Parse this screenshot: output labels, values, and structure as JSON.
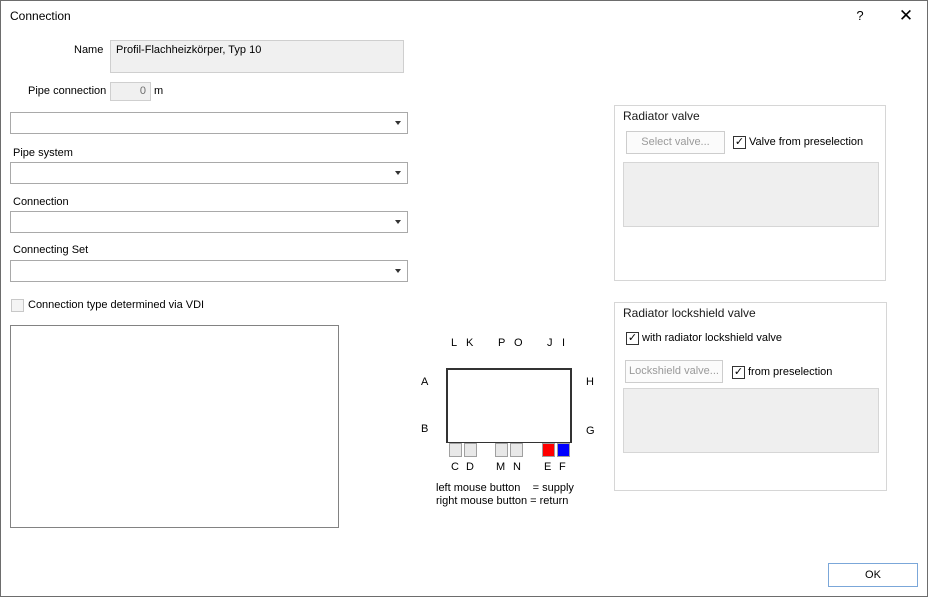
{
  "dialog": {
    "title": "Connection",
    "help": "?",
    "close": "✕"
  },
  "name": {
    "label": "Name",
    "value": "Profil-Flachheizkörper, Typ 10"
  },
  "pipe_connection": {
    "label": "Pipe connection",
    "value": "0",
    "unit": "m"
  },
  "combo_top": {
    "value": ""
  },
  "pipe_system": {
    "label": "Pipe system",
    "value": ""
  },
  "connection": {
    "label": "Connection",
    "value": ""
  },
  "connecting_set": {
    "label": "Connecting Set",
    "value": ""
  },
  "vdi_checkbox": {
    "label": "Connection type determined via VDI",
    "checked": false
  },
  "radiator_valve": {
    "title": "Radiator valve",
    "select_button": "Select valve...",
    "preselection_label": "Valve from preselection",
    "preselection_checked": true
  },
  "lockshield": {
    "title": "Radiator lockshield valve",
    "with_label": "with radiator lockshield valve",
    "with_checked": true,
    "button": "Lockshield valve...",
    "preselection_label": "from preselection",
    "preselection_checked": true
  },
  "diagram": {
    "top_letters": [
      "L",
      "K",
      "P",
      "O",
      "J",
      "I"
    ],
    "left_letters": [
      "A",
      "B"
    ],
    "right_letters": [
      "H",
      "G"
    ],
    "bottom_letters": [
      "C",
      "D",
      "M",
      "N",
      "E",
      "F"
    ],
    "supply_color": "#ff0000",
    "return_color": "#0000ff",
    "legend_left": "left mouse button    = supply",
    "legend_right": "right mouse button = return"
  },
  "ok_button": "OK"
}
